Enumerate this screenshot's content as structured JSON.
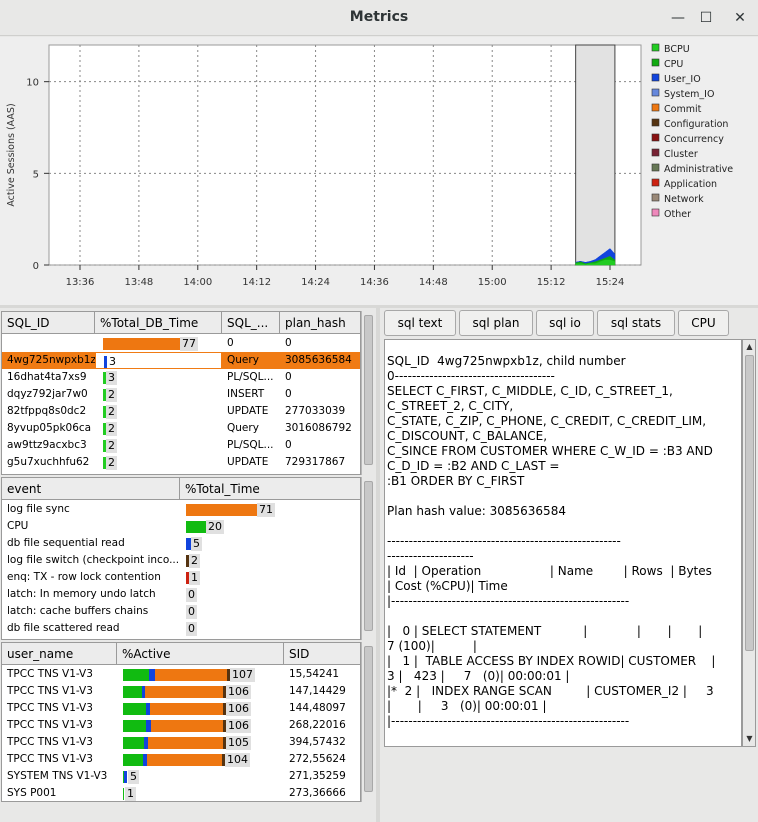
{
  "window": {
    "title": "Metrics",
    "minimize": "—",
    "maximize": "☐",
    "close": "✕"
  },
  "chart_data": {
    "type": "area",
    "ylabel": "Active Sessions (AAS)",
    "yticks": [
      "0",
      "5",
      "10"
    ],
    "ylim": [
      0,
      12
    ],
    "xticks": [
      "13:36",
      "13:48",
      "14:00",
      "14:12",
      "14:24",
      "14:36",
      "14:48",
      "15:00",
      "15:12",
      "15:24"
    ],
    "x": [
      "15:17",
      "15:18",
      "15:19",
      "15:20",
      "15:21",
      "15:22",
      "15:23",
      "15:24",
      "15:25"
    ],
    "series": [
      {
        "name": "BCPU",
        "color": "#22cc22",
        "values": [
          0.1,
          0.1,
          0.05,
          0.1,
          0.1,
          0.2,
          0.3,
          0.3,
          0.2
        ]
      },
      {
        "name": "CPU",
        "color": "#11aa11",
        "values": [
          0.05,
          0.1,
          0.05,
          0.05,
          0.1,
          0.1,
          0.1,
          0.2,
          0.1
        ]
      },
      {
        "name": "User_IO",
        "color": "#1144dd",
        "values": [
          0.0,
          0.0,
          0.05,
          0.05,
          0.1,
          0.2,
          0.3,
          0.4,
          0.3
        ]
      },
      {
        "name": "System_IO",
        "color": "#6688dd",
        "values": [
          0,
          0,
          0,
          0,
          0,
          0,
          0,
          0,
          0
        ]
      },
      {
        "name": "Commit",
        "color": "#ee7711",
        "values": [
          0,
          0,
          0,
          0,
          0,
          0,
          0,
          0,
          0
        ]
      },
      {
        "name": "Configuration",
        "color": "#553311",
        "values": [
          0,
          0,
          0,
          0,
          0,
          0,
          0,
          0,
          0
        ]
      },
      {
        "name": "Concurrency",
        "color": "#881111",
        "values": [
          0,
          0,
          0,
          0,
          0,
          0,
          0,
          0,
          0
        ]
      },
      {
        "name": "Cluster",
        "color": "#772233",
        "values": [
          0,
          0,
          0,
          0,
          0,
          0,
          0,
          0,
          0
        ]
      },
      {
        "name": "Administrative",
        "color": "#667755",
        "values": [
          0,
          0,
          0,
          0,
          0,
          0,
          0,
          0,
          0
        ]
      },
      {
        "name": "Application",
        "color": "#cc2211",
        "values": [
          0,
          0,
          0,
          0,
          0,
          0,
          0,
          0,
          0
        ]
      },
      {
        "name": "Network",
        "color": "#998877",
        "values": [
          0,
          0,
          0,
          0,
          0,
          0,
          0,
          0,
          0
        ]
      },
      {
        "name": "Other",
        "color": "#ee88bb",
        "values": [
          0,
          0,
          0,
          0,
          0,
          0,
          0,
          0,
          0
        ]
      }
    ],
    "selection_range": [
      "15:17",
      "15:25"
    ],
    "grid": true,
    "legend": "right"
  },
  "sql_table": {
    "headers": [
      "SQL_ID",
      "%Total_DB_Time",
      "SQL_...",
      "plan_hash"
    ],
    "rows": [
      {
        "id": "",
        "pct": 77,
        "type": "0",
        "plan": "0",
        "color": "#ee7711"
      },
      {
        "id": "4wg725nwpxb1z",
        "pct": 3,
        "type": "Query",
        "plan": "3085636584",
        "color": "#1144dd",
        "selected": true
      },
      {
        "id": "16dhat4ta7xs9",
        "pct": 3,
        "type": "PL/SQL...",
        "plan": "0",
        "color": "#22cc22"
      },
      {
        "id": "dqyz792jar7w0",
        "pct": 2,
        "type": "INSERT",
        "plan": "0",
        "color": "#22cc22"
      },
      {
        "id": "82tfppq8s0dc2",
        "pct": 2,
        "type": "UPDATE",
        "plan": "277033039",
        "color": "#22cc22"
      },
      {
        "id": "8yvup05pk06ca",
        "pct": 2,
        "type": "Query",
        "plan": "3016086792",
        "color": "#22cc22"
      },
      {
        "id": "aw9ttz9acxbc3",
        "pct": 2,
        "type": "PL/SQL...",
        "plan": "0",
        "color": "#22cc22"
      },
      {
        "id": "g5u7xuchhfu62",
        "pct": 2,
        "type": "UPDATE",
        "plan": "729317867",
        "color": "#22cc22"
      }
    ]
  },
  "event_table": {
    "headers": [
      "event",
      "%Total_Time"
    ],
    "rows": [
      {
        "name": "log file sync",
        "pct": 71,
        "color": "#ee7711"
      },
      {
        "name": "CPU",
        "pct": 20,
        "color": "#11bb11"
      },
      {
        "name": "db file sequential read",
        "pct": 5,
        "color": "#1144dd"
      },
      {
        "name": "log file switch (checkpoint inco...",
        "pct": 2,
        "color": "#553311"
      },
      {
        "name": "enq: TX - row lock contention",
        "pct": 1,
        "color": "#cc2211"
      },
      {
        "name": "latch: In memory undo latch",
        "pct": 0,
        "color": "#881111"
      },
      {
        "name": "latch: cache buffers chains",
        "pct": 0,
        "color": "#881111"
      },
      {
        "name": "db file scattered read",
        "pct": 0,
        "color": "#1144dd"
      }
    ]
  },
  "user_table": {
    "headers": [
      "user_name",
      "%Active",
      "SID"
    ],
    "rows": [
      {
        "name": "TPCC TNS V1-V3",
        "pct": 107,
        "sid": "15,54241",
        "cpu": 26,
        "io": 6,
        "commit": 72
      },
      {
        "name": "TPCC TNS V1-V3",
        "pct": 106,
        "sid": "147,14429",
        "cpu": 19,
        "io": 3,
        "commit": 78
      },
      {
        "name": "TPCC TNS V1-V3",
        "pct": 106,
        "sid": "144,48097",
        "cpu": 23,
        "io": 4,
        "commit": 73
      },
      {
        "name": "TPCC TNS V1-V3",
        "pct": 106,
        "sid": "268,22016",
        "cpu": 23,
        "io": 5,
        "commit": 72
      },
      {
        "name": "TPCC TNS V1-V3",
        "pct": 105,
        "sid": "394,57432",
        "cpu": 21,
        "io": 4,
        "commit": 75
      },
      {
        "name": "TPCC TNS V1-V3",
        "pct": 104,
        "sid": "272,55624",
        "cpu": 20,
        "io": 4,
        "commit": 75
      },
      {
        "name": "SYSTEM TNS V1-V3",
        "pct": 5,
        "sid": "271,35259",
        "cpu": 1,
        "io": 3,
        "commit": 0
      },
      {
        "name": "SYS P001",
        "pct": 1,
        "sid": "273,36666",
        "cpu": 1,
        "io": 0,
        "commit": 0
      }
    ]
  },
  "tabs": [
    "sql text",
    "sql plan",
    "sql io",
    "sql stats",
    "CPU"
  ],
  "sql_text": "SQL_ID  4wg725nwpxb1z, child number\n0-------------------------------------\nSELECT C_FIRST, C_MIDDLE, C_ID, C_STREET_1,\nC_STREET_2, C_CITY,\nC_STATE, C_ZIP, C_PHONE, C_CREDIT, C_CREDIT_LIM,\nC_DISCOUNT, C_BALANCE,\nC_SINCE FROM CUSTOMER WHERE C_W_ID = :B3 AND\nC_D_ID = :B2 AND C_LAST =\n:B1 ORDER BY C_FIRST\n\nPlan hash value: 3085636584\n\n------------------------------------------------------\n--------------------\n| Id  | Operation                  | Name        | Rows  | Bytes\n| Cost (%CPU)| Time\n|-------------------------------------------------------\n\n|   0 | SELECT STATEMENT           |             |       |       |\n7 (100)|          |\n|   1 |  TABLE ACCESS BY INDEX ROWID| CUSTOMER    |\n3 |   423 |     7   (0)| 00:00:01 |\n|*  2 |   INDEX RANGE SCAN         | CUSTOMER_I2 |     3\n|       |     3   (0)| 00:00:01 |\n|-------------------------------------------------------"
}
